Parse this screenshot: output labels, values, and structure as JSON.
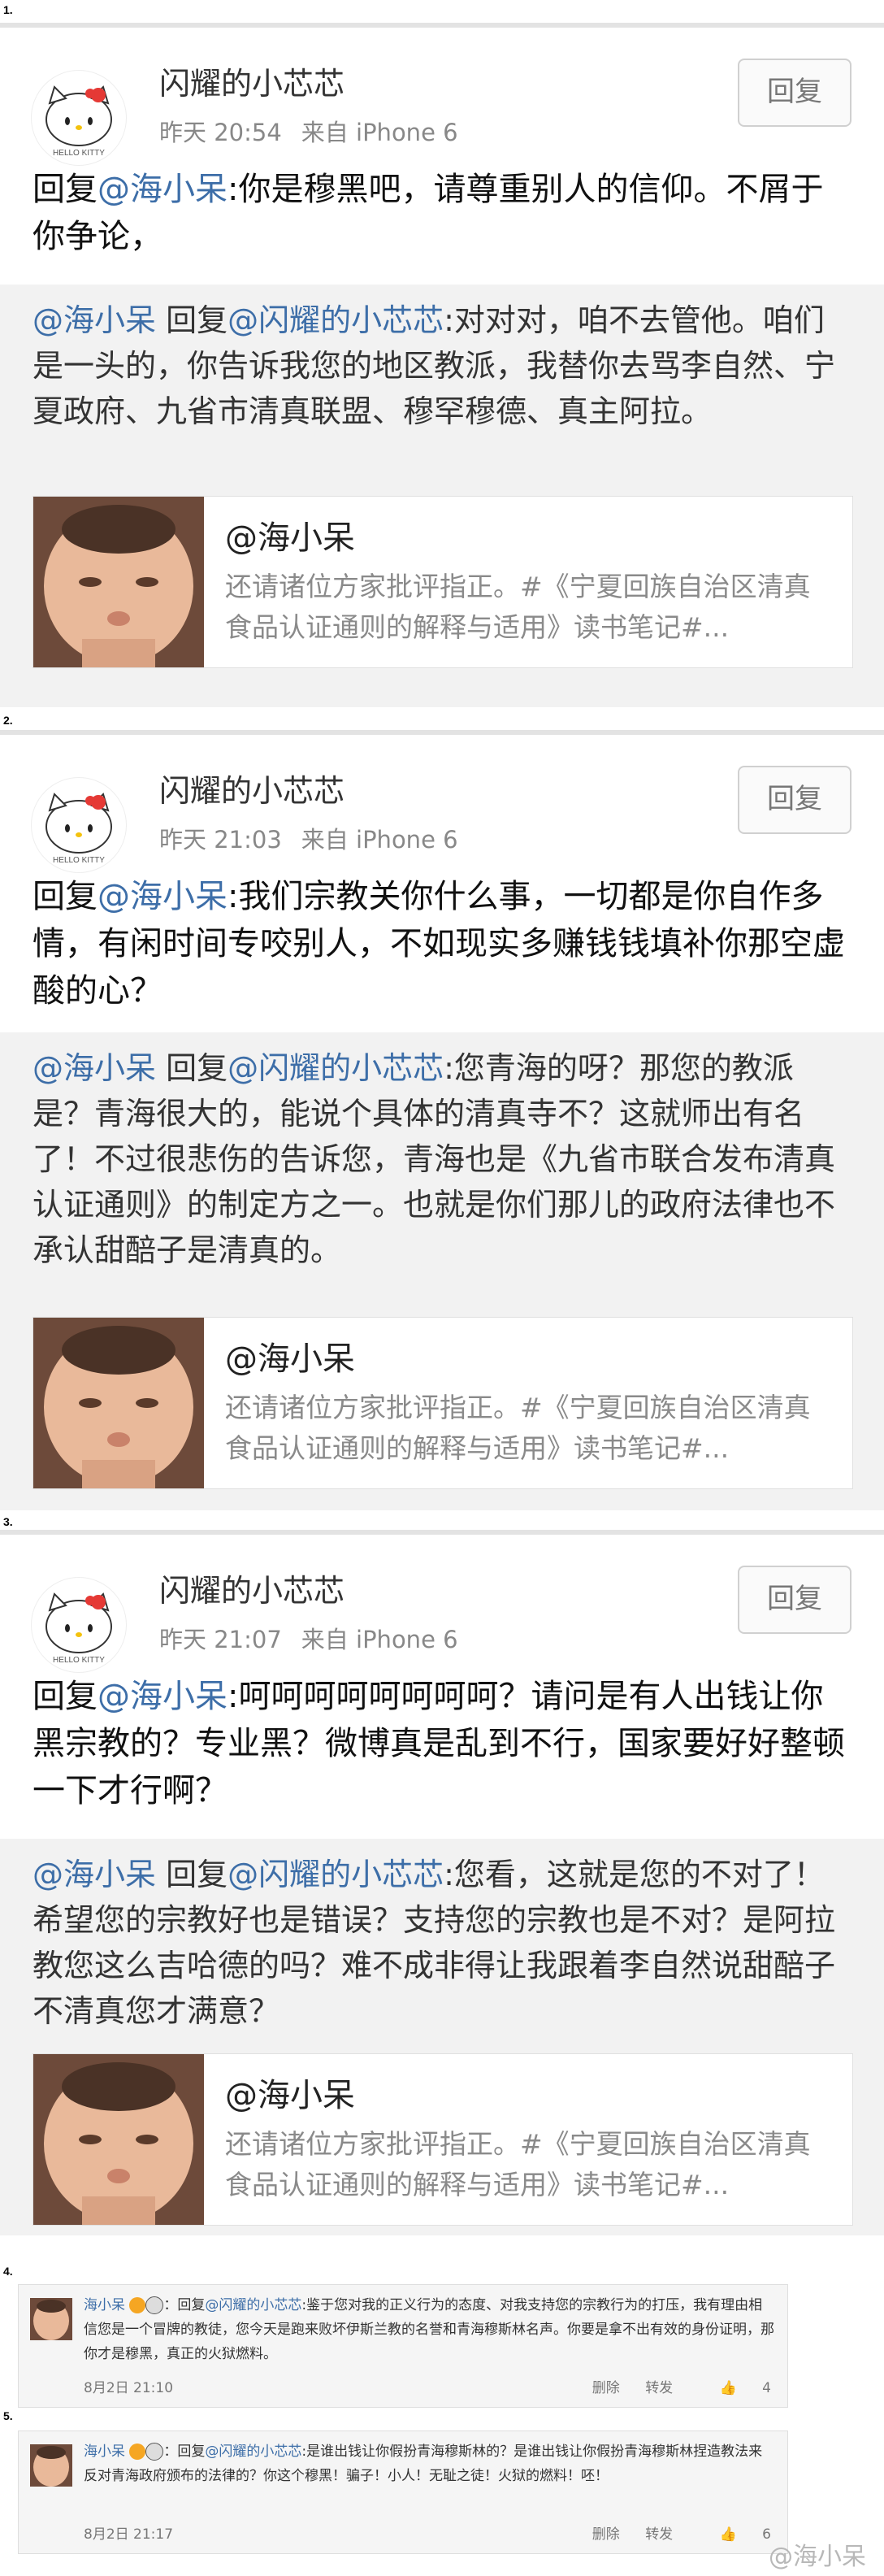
{
  "sections": [
    {
      "index": "1.",
      "username": "闪耀的小芯芯",
      "time": "昨天 20:54",
      "source": "来自 iPhone 6",
      "reply_button": "回复",
      "reply_prefix": "回复",
      "mention": "@海小呆",
      "text": ":你是穆黑吧，请尊重别人的信仰。不屑于你争论，",
      "quote_mention": "@海小呆",
      "quote_reply": " 回复",
      "quote_mention2": "@闪耀的小芯芯",
      "quote_text": ":对对对，咱不去管他。咱们是一头的，你告诉我您的地区教派，我替你去骂李自然、宁夏政府、九省市清真联盟、穆罕穆德、真主阿拉。",
      "link_title": "@海小呆",
      "link_desc": "还请诸位方家批评指正。#《宁夏回族自治区清真食品认证通则的解释与适用》读书笔记#..."
    },
    {
      "index": "2.",
      "username": "闪耀的小芯芯",
      "time": "昨天 21:03",
      "source": "来自 iPhone 6",
      "reply_button": "回复",
      "reply_prefix": "回复",
      "mention": "@海小呆",
      "text": ":我们宗教关你什么事，一切都是你自作多情，有闲时间专咬别人，不如现实多赚钱钱填补你那空虚酸的心？",
      "quote_mention": "@海小呆",
      "quote_reply": " 回复",
      "quote_mention2": "@闪耀的小芯芯",
      "quote_text": ":您青海的呀？那您的教派是？青海很大的，能说个具体的清真寺不？这就师出有名了！不过很悲伤的告诉您，青海也是《九省市联合发布清真认证通则》的制定方之一。也就是你们那儿的政府法律也不承认甜醅子是清真的。",
      "link_title": "@海小呆",
      "link_desc": "还请诸位方家批评指正。#《宁夏回族自治区清真食品认证通则的解释与适用》读书笔记#..."
    },
    {
      "index": "3.",
      "username": "闪耀的小芯芯",
      "time": "昨天 21:07",
      "source": "来自 iPhone 6",
      "reply_button": "回复",
      "reply_prefix": "回复",
      "mention": "@海小呆",
      "text": ":呵呵呵呵呵呵呵呵？请问是有人出钱让你黑宗教的？专业黑？微博真是乱到不行，国家要好好整顿一下才行啊？",
      "quote_mention": "@海小呆",
      "quote_reply": " 回复",
      "quote_mention2": "@闪耀的小芯芯",
      "quote_text": ":您看，这就是您的不对了！希望您的宗教好也是错误？支持您的宗教也是不对？是阿拉教您这么吉哈德的吗？难不成非得让我跟着李自然说甜醅子不清真您才满意？",
      "link_title": "@海小呆",
      "link_desc": "还请诸位方家批评指正。#《宁夏回族自治区清真食品认证通则的解释与适用》读书笔记#..."
    }
  ],
  "small_comments": [
    {
      "index": "4.",
      "name": "海小呆",
      "text_prefix": "：回复",
      "mention": "@闪耀的小芯芯",
      "text": ":鉴于您对我的正义行为的态度、对我支持您的宗教行为的打压，我有理由相信您是一个冒牌的教徒，您今天是跑来败坏伊斯兰教的名誉和青海穆斯林名声。你要是拿不出有效的身份证明，那你才是穆黑，真正的火狱燃料。",
      "date": "8月2日 21:10",
      "delete": "删除",
      "forward": "转发",
      "likes": "4"
    },
    {
      "index": "5.",
      "name": "海小呆",
      "text_prefix": "：回复",
      "mention": "@闪耀的小芯芯",
      "text": ":是谁出钱让你假扮青海穆斯林的？是谁出钱让你假扮青海穆斯林捏造教法来反对青海政府颁布的法律的？你这个穆黑！骗子！小人！无耻之徒！火狱的燃料！呸！",
      "date": "8月2日 21:17",
      "delete": "删除",
      "forward": "转发",
      "likes": "6"
    }
  ],
  "watermark": "@海小呆",
  "colors": {
    "mention": "#3d6ea8",
    "quote_bg": "#f2f2f2",
    "meta": "#888888"
  }
}
